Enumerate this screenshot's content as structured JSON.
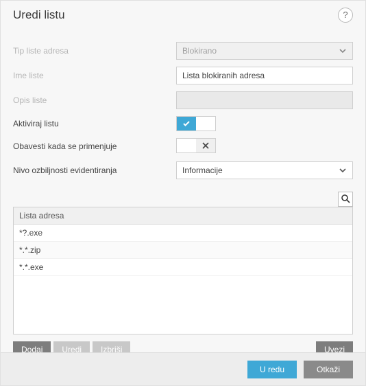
{
  "header": {
    "title": "Uredi listu"
  },
  "form": {
    "type_label": "Tip liste adresa",
    "type_value": "Blokirano",
    "name_label": "Ime liste",
    "name_value": "Lista blokiranih adresa",
    "desc_label": "Opis liste",
    "desc_value": "",
    "activate_label": "Aktiviraj listu",
    "activate_on": true,
    "notify_label": "Obavesti kada se primenjuje",
    "notify_on": false,
    "severity_label": "Nivo ozbiljnosti evidentiranja",
    "severity_value": "Informacije"
  },
  "grid": {
    "header": "Lista adresa",
    "rows": [
      "*?.exe",
      "*.*.zip",
      "*.*.exe"
    ]
  },
  "actions": {
    "add": "Dodaj",
    "edit": "Uredi",
    "delete": "Izbriši",
    "import": "Uvezi"
  },
  "footer": {
    "ok": "U redu",
    "cancel": "Otkaži"
  }
}
